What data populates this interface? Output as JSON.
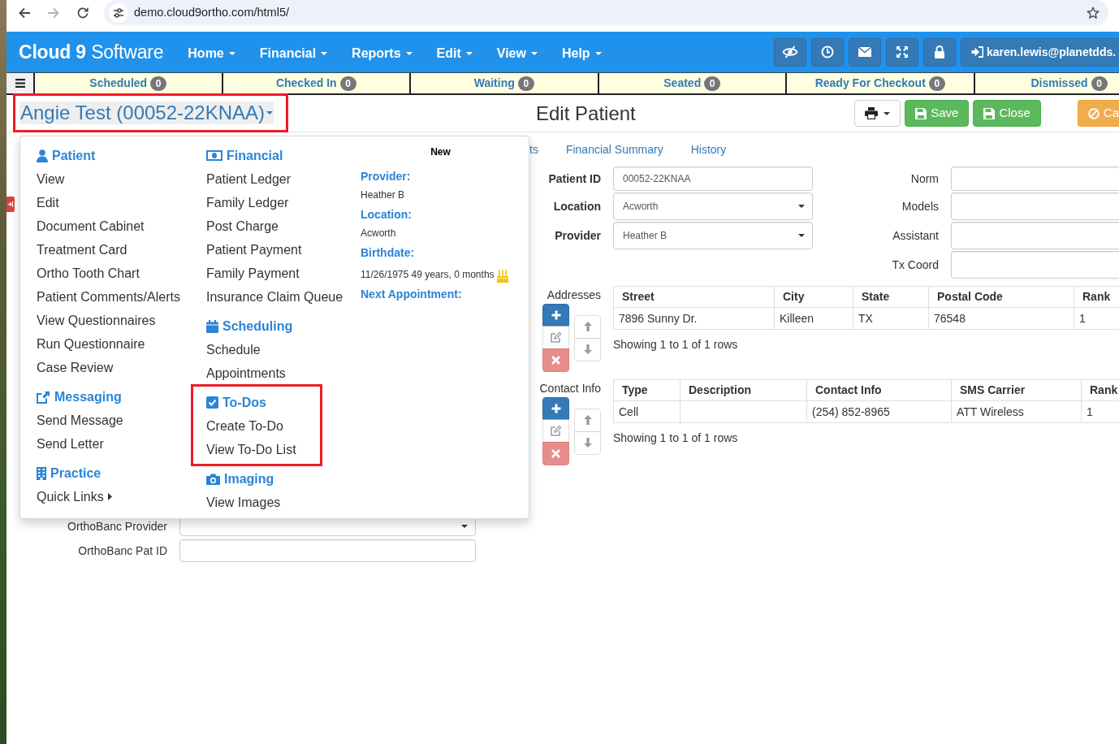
{
  "browser": {
    "url": "demo.cloud9ortho.com/html5/",
    "can_go_forward": false
  },
  "navbar": {
    "brand": "**Cloud 9** Software",
    "menus": [
      "Home",
      "Financial",
      "Reports",
      "Edit",
      "View",
      "Help"
    ],
    "user": "karen.lewis@planetdds."
  },
  "status_tabs": [
    {
      "label": "Scheduled",
      "count": "0"
    },
    {
      "label": "Checked In",
      "count": "0"
    },
    {
      "label": "Waiting",
      "count": "0"
    },
    {
      "label": "Seated",
      "count": "0"
    },
    {
      "label": "Ready For Checkout",
      "count": "0"
    },
    {
      "label": "Dismissed",
      "count": "0"
    }
  ],
  "patient_selector": {
    "label": "Angie Test (00052-22KNAA)",
    "highlighted": true
  },
  "page_title": "Edit Patient",
  "actions": [
    {
      "kind": "print"
    },
    {
      "kind": "save",
      "label": "Save"
    },
    {
      "kind": "close",
      "label": "Close"
    },
    {
      "kind": "cancel",
      "label": "Ca"
    }
  ],
  "patient_menu": {
    "columns": [
      [
        {
          "title": "Patient",
          "kind": "patient",
          "highlighted": false,
          "items": [
            {
              "label": "View"
            },
            {
              "label": "Edit"
            },
            {
              "label": "Document Cabinet"
            },
            {
              "label": "Treatment Card"
            },
            {
              "label": "Ortho Tooth Chart"
            },
            {
              "label": "Patient Comments/Alerts"
            },
            {
              "label": "View Questionnaires"
            },
            {
              "label": "Run Questionnaire"
            },
            {
              "label": "Case Review"
            }
          ]
        },
        {
          "title": "Messaging",
          "kind": "messaging",
          "highlighted": false,
          "items": [
            {
              "label": "Send Message"
            },
            {
              "label": "Send Letter"
            }
          ]
        },
        {
          "title": "Practice",
          "kind": "practice",
          "highlighted": false,
          "items": [
            {
              "label": "Quick Links",
              "submenu": true
            }
          ]
        }
      ],
      [
        {
          "title": "Financial",
          "kind": "financial",
          "highlighted": false,
          "items": [
            {
              "label": "Patient Ledger"
            },
            {
              "label": "Family Ledger"
            },
            {
              "label": "Post Charge"
            },
            {
              "label": "Patient Payment"
            },
            {
              "label": "Family Payment"
            },
            {
              "label": "Insurance Claim Queue"
            }
          ]
        },
        {
          "title": "Scheduling",
          "kind": "scheduling",
          "highlighted": false,
          "items": [
            {
              "label": "Schedule"
            },
            {
              "label": "Appointments"
            }
          ]
        },
        {
          "title": "To-Dos",
          "kind": "todos",
          "highlighted": true,
          "items": [
            {
              "label": "Create To-Do"
            },
            {
              "label": "View To-Do List"
            }
          ]
        },
        {
          "title": "Imaging",
          "kind": "imaging",
          "highlighted": false,
          "items": [
            {
              "label": "View Images"
            }
          ]
        }
      ]
    ],
    "summary": {
      "status": "New",
      "fields": [
        {
          "label": "Provider:",
          "value": "Heather B",
          "birthday": false
        },
        {
          "label": "Location:",
          "value": "Acworth",
          "birthday": false
        },
        {
          "label": "Birthdate:",
          "value": "11/26/1975 49 years, 0 months",
          "birthday": true
        },
        {
          "label": "Next Appointment:",
          "birthday": false
        }
      ]
    }
  },
  "tabs": [
    {
      "label": "ts",
      "selected": false
    },
    {
      "label": "Financial Summary",
      "selected": false
    },
    {
      "label": "History",
      "selected": false
    }
  ],
  "form": {
    "left": [
      {
        "label": "Patient ID",
        "kind": "input",
        "value": "00052-22KNAA"
      },
      {
        "label": "Location",
        "kind": "select",
        "value": "Acworth"
      },
      {
        "label": "Provider",
        "kind": "select",
        "value": "Heather B"
      }
    ],
    "right": [
      {
        "label": "Norm",
        "kind": "input"
      },
      {
        "label": "Models",
        "kind": "input"
      },
      {
        "label": "Assistant",
        "kind": "input"
      },
      {
        "label": "Tx Coord",
        "kind": "input"
      }
    ]
  },
  "addresses": {
    "label": "Addresses",
    "toolbar": [
      {
        "kind": "add",
        "disabled": false
      },
      {
        "kind": "edit",
        "disabled": true
      },
      {
        "kind": "remove",
        "disabled": true
      }
    ],
    "order_buttons": [
      {
        "kind": "up",
        "disabled": true
      },
      {
        "kind": "down",
        "disabled": true
      }
    ],
    "columns": [
      "Street",
      "City",
      "State",
      "Postal Code",
      "Rank"
    ],
    "rows": [
      [
        "7896 Sunny Dr.",
        "Killeen",
        "TX",
        "76548",
        "1"
      ]
    ],
    "footer": "Showing 1 to 1 of 1 rows"
  },
  "contact_info": {
    "label": "Contact Info",
    "toolbar": [
      {
        "kind": "add",
        "disabled": false
      },
      {
        "kind": "edit",
        "disabled": true
      },
      {
        "kind": "remove",
        "disabled": true
      }
    ],
    "order_buttons": [
      {
        "kind": "up",
        "disabled": true
      },
      {
        "kind": "down",
        "disabled": true
      }
    ],
    "columns": [
      "Type",
      "Description",
      "Contact Info",
      "SMS Carrier",
      "Rank"
    ],
    "rows": [
      [
        "Cell",
        null,
        "(254) 852-8965",
        "ATT Wireless",
        "1"
      ]
    ],
    "footer": "Showing 1 to 1 of 1 rows"
  },
  "orthobanc_fields": [
    {
      "label": "OrthoBanc Provider",
      "kind": "select"
    },
    {
      "label": "OrthoBanc Pat ID",
      "kind": "input"
    }
  ]
}
